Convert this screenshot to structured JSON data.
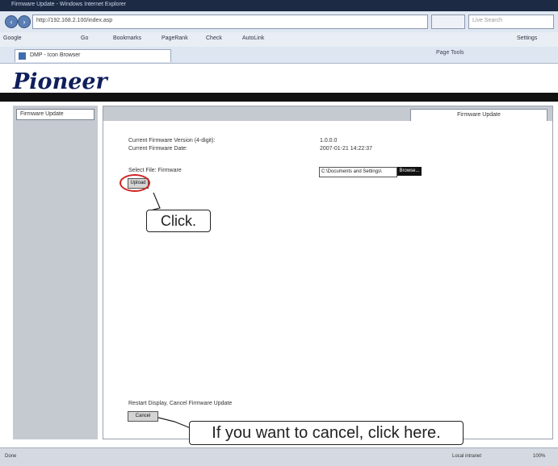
{
  "browser": {
    "title": "Firmware Update - Windows Internet Explorer",
    "address": "http://192.168.2.100/index.asp",
    "search_placeholder": "Live Search",
    "toolbar_items": [
      "Google",
      "Go",
      "Bookmarks",
      "PageRank",
      "Check",
      "AutoLink",
      "Settings"
    ],
    "tab_label": "DMP - Icon Browser",
    "tab_tools": "Page  Tools",
    "status_left": "Done",
    "status_zone": "Local intranet",
    "status_zoom": "100%"
  },
  "brand": {
    "logo": "Pioneer"
  },
  "sidebar": {
    "menu_item": "Firmware Update"
  },
  "main": {
    "tab": "Firmware Update",
    "current_version_label": "Current Firmware Version (4-digit):",
    "current_date_label": "Current Firmware Date:",
    "current_version_value": "1.0.0.0",
    "current_date_value": "2007-01-21  14:22:37",
    "select_label": "Select File: Firmware",
    "upload_button": "Upload",
    "file_value": "C:\\Documents and Settings\\",
    "browse_button": "Browse...",
    "cancel_hint": "Restart Display, Cancel Firmware Update",
    "cancel_button": "Cancel"
  },
  "annotations": {
    "click": "Click.",
    "cancel_tip": "If you want to cancel, click here."
  },
  "colors": {
    "annotation_ring": "#d12222",
    "logo": "#0f1f5c",
    "sidebar": "#c5c9d0"
  }
}
